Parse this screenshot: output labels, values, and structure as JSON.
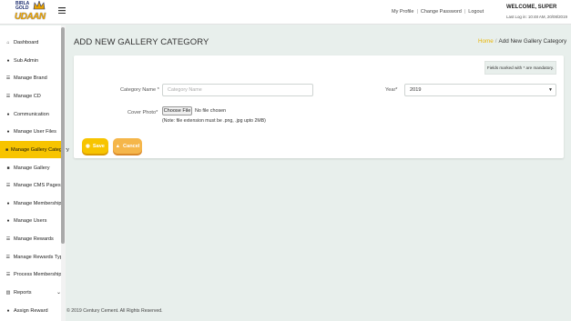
{
  "header": {
    "logo_line1": "BIRLA",
    "logo_line2": "GOLD",
    "logo_line3": "UDAAN",
    "links": [
      "My Profile",
      "Change Password",
      "Logout"
    ],
    "welcome": "WELCOME, SUPER",
    "last_login": "Last Log in: 10:48 AM, 20/08/2019"
  },
  "sidebar": {
    "items": [
      {
        "label": "Dashboard",
        "icon": "home-icon"
      },
      {
        "label": "Sub Admin",
        "icon": "user-icon"
      },
      {
        "label": "Manage Brand",
        "icon": "list-icon"
      },
      {
        "label": "Manage CD",
        "icon": "list-icon"
      },
      {
        "label": "Communication",
        "icon": "user-icon"
      },
      {
        "label": "Manage User Files",
        "icon": "user-icon"
      },
      {
        "label": "Manage Gallery Category",
        "icon": "lock-icon"
      },
      {
        "label": "Manage Gallery",
        "icon": "lock-icon"
      },
      {
        "label": "Manage CMS Pages",
        "icon": "list-icon"
      },
      {
        "label": "Manage Memberships",
        "icon": "users-icon"
      },
      {
        "label": "Manage Users",
        "icon": "user-icon"
      },
      {
        "label": "Manage Rewards",
        "icon": "list-icon"
      },
      {
        "label": "Manage Rewards Type",
        "icon": "list-icon"
      },
      {
        "label": "Process Membership",
        "icon": "list-icon"
      },
      {
        "label": "Reports",
        "icon": "chart-icon"
      },
      {
        "label": "Assign Reward",
        "icon": "user-icon"
      }
    ],
    "active_index": 6
  },
  "page": {
    "title": "ADD NEW GALLERY CATEGORY",
    "breadcrumb_home": "Home",
    "breadcrumb_sep": "/",
    "breadcrumb_current": "Add New Gallery Category"
  },
  "form": {
    "mandatory_note": "Fields marked with * are mandatory.",
    "category_label": "Category Name *",
    "category_placeholder": "Category Name",
    "year_label": "Year*",
    "year_value": "2019",
    "cover_label": "Cover Photo*",
    "choose_file": "Choose File",
    "no_file": "No file chosen",
    "file_note": "(Note: file extension must be .png, .jpg upto 2MB)",
    "save": "Save",
    "cancel": "Cancel"
  },
  "footer": "© 2019 Century Cement. All Rights Reserved.",
  "colors": {
    "accent": "#f7c400",
    "active_nav": "#f7c400",
    "page_bg": "#e8efec",
    "cancel": "#f5b64a"
  }
}
